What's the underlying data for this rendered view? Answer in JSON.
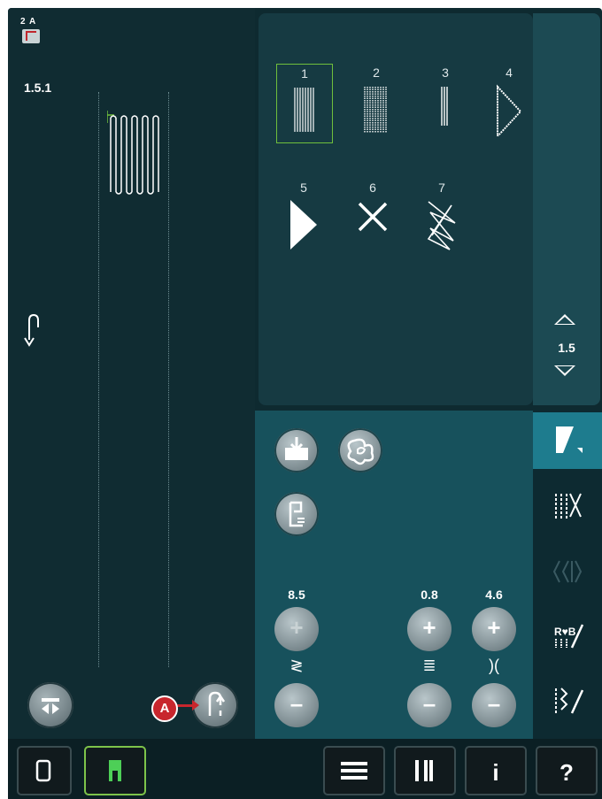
{
  "preview": {
    "presser_foot": "2 A",
    "stitch_id": "1.5.1"
  },
  "callout": {
    "label": "A"
  },
  "stitch_menu": {
    "stitches": [
      {
        "number": "1",
        "selected": true
      },
      {
        "number": "2",
        "selected": false
      },
      {
        "number": "3",
        "selected": false
      },
      {
        "number": "4",
        "selected": false
      },
      {
        "number": "5",
        "selected": false
      },
      {
        "number": "6",
        "selected": false
      },
      {
        "number": "7",
        "selected": false
      }
    ],
    "scroll": {
      "value": "1.5"
    }
  },
  "parameters": {
    "width": {
      "value": "8.5"
    },
    "density": {
      "value": "0.8"
    },
    "balance": {
      "value": "4.6"
    }
  },
  "colors": {
    "background": "#0e2a30",
    "panel": "#163a42",
    "accent_green": "#6fbf3c",
    "active_tab": "#1e7c8e",
    "callout_red": "#c8262d"
  },
  "icons": [
    "save-icon",
    "ribbon-icon",
    "tie-off-icon",
    "mirror-icon",
    "tapering-icon",
    "stitch-menu-icon",
    "cut-tie-icon",
    "selection-icon",
    "sequence-icon",
    "edit-stitch-icon",
    "settings-tools-icon",
    "info-icon",
    "help-icon",
    "list-icon",
    "sewing-mode-icon",
    "embroidery-mode-icon"
  ],
  "bottombar": {
    "help_label": "?",
    "info_label": "i"
  }
}
